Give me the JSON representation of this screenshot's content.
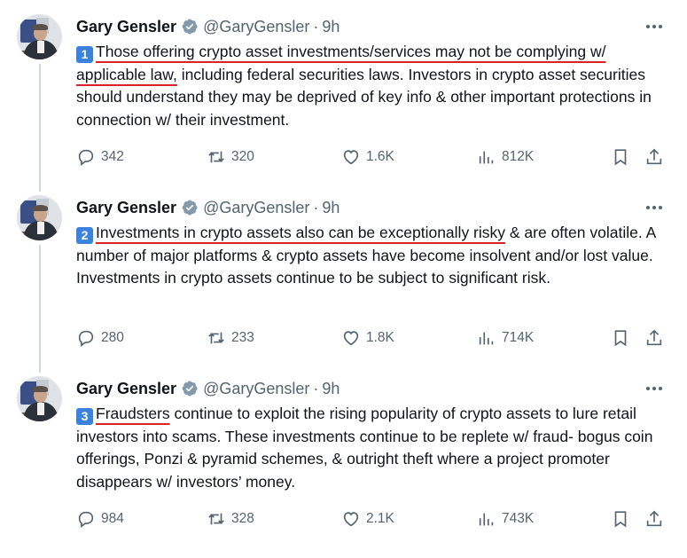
{
  "tweets": [
    {
      "author": "Gary Gensler",
      "handle": "@GaryGensler",
      "separator": "·",
      "time": "9h",
      "number": "1",
      "highlight": "Those offering crypto asset investments/services may not be complying w/ applicable law,",
      "text": " including federal securities laws. Investors in crypto asset securities should understand they may be deprived of key info & other important protections in connection w/ their investment.",
      "stats": {
        "replies": "342",
        "reposts": "320",
        "likes": "1.6K",
        "views": "812K"
      }
    },
    {
      "author": "Gary Gensler",
      "handle": "@GaryGensler",
      "separator": "·",
      "time": "9h",
      "number": "2",
      "highlight": "Investments in crypto assets also can be exceptionally risky",
      "text": " & are often volatile. A number of major platforms & crypto assets have become insolvent and/or lost value. Investments in crypto assets continue to be subject to significant risk.",
      "stats": {
        "replies": "280",
        "reposts": "233",
        "likes": "1.8K",
        "views": "714K"
      }
    },
    {
      "author": "Gary Gensler",
      "handle": "@GaryGensler",
      "separator": "·",
      "time": "9h",
      "number": "3",
      "highlight": "Fraudsters",
      "text": " continue to exploit the rising popularity of crypto assets to lure retail investors into scams. These investments continue to be replete w/ fraud- bogus coin offerings, Ponzi & pyramid schemes, & outright theft where a project promoter disappears w/ investors’ money.",
      "stats": {
        "replies": "984",
        "reposts": "328",
        "likes": "2.1K",
        "views": "743K"
      }
    }
  ],
  "icons": {
    "verified": "verified-badge-icon",
    "more": "more-dots-icon",
    "reply": "reply-icon",
    "repost": "repost-icon",
    "like": "heart-icon",
    "views": "views-chart-icon",
    "bookmark": "bookmark-icon",
    "share": "share-icon"
  },
  "colors": {
    "badge_blue": "#3b82dc",
    "verified_gray": "#829aab",
    "underline_red": "#d8232a",
    "secondary_text": "#536471"
  }
}
